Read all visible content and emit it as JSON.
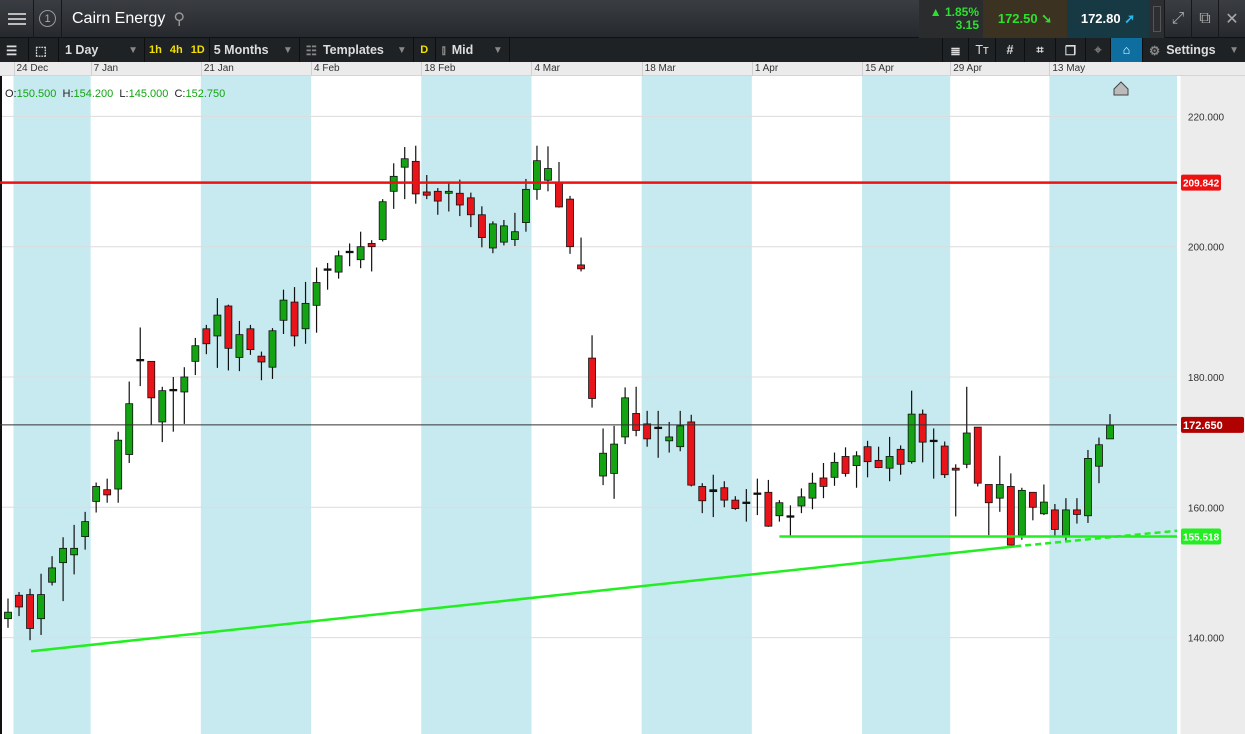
{
  "header": {
    "title": "Cairn Energy",
    "tab_number": "1",
    "change_pct": "1.85%",
    "change_abs": "3.15",
    "sell_price": "172.50",
    "buy_price": "172.80"
  },
  "toolbar": {
    "interval": "1 Day",
    "quick": [
      "1h",
      "4h",
      "1D"
    ],
    "range": "5 Months",
    "templates": "Templates",
    "d_label": "D",
    "price_type": "Mid",
    "settings": "Settings"
  },
  "ohlc": {
    "o_label": "O:",
    "o": "150.500",
    "h_label": "H:",
    "h": "154.200",
    "l_label": "L:",
    "l": "145.000",
    "c_label": "C:",
    "c": "152.750"
  },
  "colors": {
    "up": "#13a313",
    "down": "#e8141a",
    "band": "#c7eaf0",
    "resistance": "#ee1111",
    "support": "#22ee22",
    "current": "#b00000"
  },
  "chart_data": {
    "type": "candlestick",
    "title": "Cairn Energy",
    "ylim": [
      125.2,
      226.2
    ],
    "yticks": [
      140,
      160,
      180,
      200,
      220
    ],
    "ytick_labels": [
      "140.000",
      "160.000",
      "180.000",
      "200.000",
      "220.000"
    ],
    "date_ticks": [
      {
        "idx": 0.5,
        "label": "24 Dec"
      },
      {
        "idx": 7.5,
        "label": "7 Jan"
      },
      {
        "idx": 17.5,
        "label": "21 Jan"
      },
      {
        "idx": 27.5,
        "label": "4 Feb"
      },
      {
        "idx": 37.5,
        "label": "18 Feb"
      },
      {
        "idx": 47.5,
        "label": "4 Mar"
      },
      {
        "idx": 57.5,
        "label": "18 Mar"
      },
      {
        "idx": 67.5,
        "label": "1 Apr"
      },
      {
        "idx": 77.5,
        "label": "15 Apr"
      },
      {
        "idx": 85.5,
        "label": "29 Apr"
      },
      {
        "idx": 94.5,
        "label": "13 May"
      }
    ],
    "shaded_bands": [
      [
        0.5,
        7.5
      ],
      [
        17.5,
        27.5
      ],
      [
        37.5,
        47.5
      ],
      [
        57.5,
        67.5
      ],
      [
        77.5,
        85.5
      ],
      [
        94.5,
        106.2
      ]
    ],
    "candles": [
      [
        142.9,
        143.9,
        146,
        141.5
      ],
      [
        146.5,
        144.7,
        147,
        143.3
      ],
      [
        146.6,
        141.4,
        147.5,
        139.6
      ],
      [
        142.9,
        146.6,
        149.8,
        140.4
      ],
      [
        148.5,
        150.7,
        152.5,
        148
      ],
      [
        151.5,
        153.7,
        155.4,
        145.6
      ],
      [
        152.7,
        153.7,
        157.3,
        149.7
      ],
      [
        155.5,
        157.8,
        159.3,
        153.5
      ],
      [
        160.9,
        163.2,
        163.8,
        159.2
      ],
      [
        162.7,
        161.9,
        164.4,
        160.7
      ],
      [
        162.8,
        170.3,
        171.6,
        160.7
      ],
      [
        168.1,
        175.9,
        179.3,
        166.8
      ],
      [
        182.5,
        182.7,
        187.6,
        178.6
      ],
      [
        182.4,
        176.8,
        182.4,
        172.7
      ],
      [
        173.1,
        177.9,
        178.5,
        170
      ],
      [
        178,
        178.1,
        180,
        171.6
      ],
      [
        177.7,
        180,
        181.5,
        172.8
      ],
      [
        182.4,
        184.8,
        186,
        180.3
      ],
      [
        187.4,
        185.1,
        188,
        183.5
      ],
      [
        186.3,
        189.5,
        192.1,
        181.4
      ],
      [
        190.9,
        184.4,
        191.1,
        181
      ],
      [
        183,
        186.5,
        188.6,
        180.9
      ],
      [
        187.4,
        184.2,
        188,
        183.4
      ],
      [
        183.2,
        182.3,
        183.9,
        179.5
      ],
      [
        181.5,
        187.1,
        187.5,
        179.7
      ],
      [
        188.7,
        191.8,
        193.4,
        186.6
      ],
      [
        191.5,
        186.3,
        193.8,
        184.7
      ],
      [
        187.4,
        191.3,
        194.6,
        185.1
      ],
      [
        191,
        194.5,
        196.8,
        186.8
      ],
      [
        196.4,
        196.6,
        197.5,
        193.4
      ],
      [
        196.1,
        198.6,
        199.4,
        195.1
      ],
      [
        199.1,
        199.3,
        200.5,
        197
      ],
      [
        198,
        200,
        202.3,
        196.7
      ],
      [
        200.5,
        200,
        201,
        196.2
      ],
      [
        201.1,
        206.9,
        207.3,
        200.8
      ],
      [
        208.5,
        210.8,
        212.8,
        205.8
      ],
      [
        212.2,
        213.5,
        215.3,
        207.3
      ],
      [
        213.1,
        208.1,
        215.5,
        206.6
      ],
      [
        208.4,
        207.9,
        211,
        207.3
      ],
      [
        208.5,
        207,
        209,
        204.9
      ],
      [
        208.2,
        208.5,
        210,
        205.4
      ],
      [
        208.2,
        206.4,
        210.3,
        204.7
      ],
      [
        207.5,
        204.9,
        208.3,
        203
      ],
      [
        204.9,
        201.4,
        206.2,
        199.9
      ],
      [
        199.8,
        203.5,
        203.9,
        199
      ],
      [
        200.7,
        203.2,
        204.1,
        200.2
      ],
      [
        201.1,
        202.3,
        205.2,
        200.1
      ],
      [
        203.7,
        208.8,
        210.4,
        202.3
      ],
      [
        208.8,
        213.2,
        215.5,
        207.2
      ],
      [
        210.2,
        212,
        215.4,
        208.5
      ],
      [
        209.9,
        206.1,
        213,
        206
      ],
      [
        207.3,
        200,
        207.8,
        198.9
      ],
      [
        197.2,
        196.6,
        201.4,
        196.2
      ],
      [
        182.9,
        176.7,
        186.4,
        175.3
      ],
      [
        164.8,
        168.3,
        172.1,
        163.4
      ],
      [
        165.2,
        169.7,
        172.5,
        161.3
      ],
      [
        170.8,
        176.8,
        178.4,
        169.7
      ],
      [
        174.4,
        171.8,
        178.5,
        170.9
      ],
      [
        172.8,
        170.5,
        174.8,
        169.3
      ],
      [
        172.1,
        172.3,
        174.8,
        167.6
      ],
      [
        170.2,
        170.8,
        173.1,
        168.4
      ],
      [
        169.3,
        172.5,
        174.8,
        168.6
      ],
      [
        173.1,
        163.4,
        174.2,
        163.2
      ],
      [
        163.2,
        161,
        163.7,
        159.1
      ],
      [
        162.4,
        162.7,
        165,
        158.5
      ],
      [
        163,
        161.1,
        164,
        160
      ],
      [
        161.1,
        159.8,
        161.7,
        159.6
      ],
      [
        160.6,
        160.8,
        162.8,
        157.8
      ],
      [
        162,
        162.2,
        164.4,
        158.8
      ],
      [
        162.3,
        157.1,
        164.2,
        157
      ],
      [
        158.7,
        160.7,
        161.1,
        157.8
      ],
      [
        158.5,
        158.7,
        160.3,
        155.6
      ],
      [
        160.2,
        161.6,
        162.9,
        159.1
      ],
      [
        161.4,
        163.7,
        165.3,
        159.7
      ],
      [
        164.5,
        163.2,
        166.8,
        161.4
      ],
      [
        164.6,
        166.9,
        168.4,
        163.3
      ],
      [
        167.8,
        165.2,
        169.2,
        164.7
      ],
      [
        166.4,
        167.9,
        168.6,
        163
      ],
      [
        169.3,
        167,
        170.2,
        164.6
      ],
      [
        167.2,
        166.1,
        169.3,
        166
      ],
      [
        166,
        167.8,
        170.8,
        164
      ],
      [
        168.9,
        166.6,
        169.5,
        165
      ],
      [
        167,
        174.3,
        177.9,
        166.7
      ],
      [
        174.3,
        170,
        175,
        166.9
      ],
      [
        170.1,
        170.3,
        172.1,
        164.4
      ],
      [
        169.4,
        165,
        170.1,
        164.5
      ],
      [
        166,
        165.7,
        166.6,
        158.6
      ],
      [
        166.6,
        171.4,
        178.5,
        166
      ],
      [
        172.3,
        163.7,
        172.3,
        163.2
      ],
      [
        163.5,
        160.7,
        163.5,
        155.7
      ],
      [
        161.4,
        163.5,
        167.9,
        159.3
      ],
      [
        163.2,
        154.2,
        165.2,
        154.2
      ],
      [
        155.7,
        162.6,
        163,
        155
      ],
      [
        162.3,
        160,
        162.3,
        158
      ],
      [
        159,
        160.8,
        163.5,
        158.8
      ],
      [
        159.6,
        156.6,
        160.5,
        155.5
      ],
      [
        155.5,
        159.6,
        161.4,
        154.8
      ],
      [
        159.6,
        158.9,
        161.4,
        157.5
      ],
      [
        158.7,
        167.5,
        168.8,
        157.6
      ],
      [
        166.3,
        169.6,
        170.7,
        163.7
      ],
      [
        170.5,
        172.6,
        174.3,
        170.5
      ]
    ],
    "candle_format": [
      "open",
      "close",
      "high",
      "low"
    ],
    "horizontal_lines": [
      {
        "name": "resistance",
        "price": 209.842,
        "label": "209.842"
      },
      {
        "name": "support",
        "price": 155.518,
        "label": "155.518",
        "from_idx": 70
      },
      {
        "name": "current-price",
        "price": 172.65,
        "label": "172.650"
      }
    ],
    "trendline": {
      "from": [
        2.1,
        137.9
      ],
      "to": [
        91.4,
        154.0
      ],
      "extension_to": [
        106.2,
        156.4
      ]
    }
  }
}
